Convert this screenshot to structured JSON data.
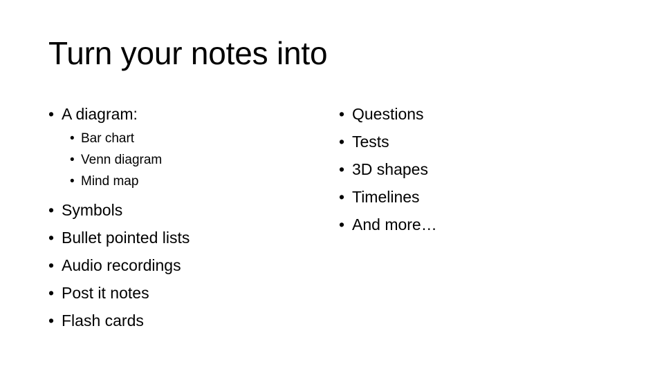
{
  "slide": {
    "title": "Turn your notes into",
    "bullet_glyph": "•",
    "text_color": "#000000",
    "background_color": "#ffffff",
    "left_column": [
      {
        "level": 1,
        "label": "A diagram:",
        "children": [
          {
            "level": 2,
            "label": "Bar chart"
          },
          {
            "level": 2,
            "label": "Venn diagram"
          },
          {
            "level": 2,
            "label": "Mind map"
          }
        ]
      },
      {
        "level": 1,
        "label": "Symbols"
      },
      {
        "level": 1,
        "label": "Bullet pointed lists"
      },
      {
        "level": 1,
        "label": "Audio recordings"
      },
      {
        "level": 1,
        "label": "Post it notes"
      },
      {
        "level": 1,
        "label": "Flash cards"
      }
    ],
    "right_column": [
      {
        "level": 1,
        "label": "Questions"
      },
      {
        "level": 1,
        "label": "Tests"
      },
      {
        "level": 1,
        "label": "3D shapes"
      },
      {
        "level": 1,
        "label": "Timelines"
      },
      {
        "level": 1,
        "label": "And more…"
      }
    ]
  }
}
